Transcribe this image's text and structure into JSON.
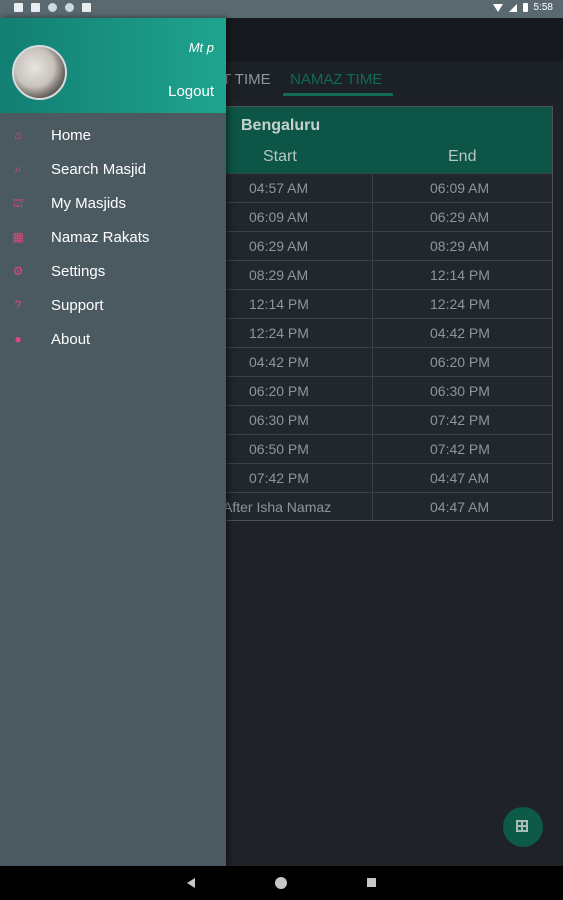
{
  "status_bar": {
    "time": "5:58",
    "left_icons": [
      "notification-icon",
      "gallery-icon",
      "google-icon",
      "circle-icon",
      "file-icon"
    ]
  },
  "tabs": {
    "first_partial": "T TIME",
    "active": "NAMAZ TIME"
  },
  "table": {
    "city": "Bengaluru",
    "headers": {
      "start": "Start",
      "end": "End"
    },
    "rows": [
      {
        "start": "04:57 AM",
        "end": "06:09 AM"
      },
      {
        "start": "06:09 AM",
        "end": "06:29 AM"
      },
      {
        "start": "06:29 AM",
        "end": "08:29 AM"
      },
      {
        "start": "08:29 AM",
        "end": "12:14 PM"
      },
      {
        "start": "12:14 PM",
        "end": "12:24 PM"
      },
      {
        "start": "12:24 PM",
        "end": "04:42 PM"
      },
      {
        "start": "04:42 PM",
        "end": "06:20 PM"
      },
      {
        "start": "06:20 PM",
        "end": "06:30 PM"
      },
      {
        "start": "06:30 PM",
        "end": "07:42 PM"
      },
      {
        "start": "06:50 PM",
        "end": "07:42 PM"
      },
      {
        "start": "07:42 PM",
        "end": "04:47 AM"
      },
      {
        "start": "After Isha Namaz",
        "end": "04:47 AM"
      }
    ]
  },
  "drawer": {
    "user_name": "Mt p",
    "logout_label": "Logout",
    "accent_color": "#e0477d",
    "items": [
      {
        "label": "Home",
        "icon": "home-icon"
      },
      {
        "label": "Search Masjid",
        "icon": "search-icon"
      },
      {
        "label": "My Masjids",
        "icon": "masjid-icon"
      },
      {
        "label": "Namaz Rakats",
        "icon": "table-icon"
      },
      {
        "label": "Settings",
        "icon": "gear-icon"
      },
      {
        "label": "Support",
        "icon": "help-icon"
      },
      {
        "label": "About",
        "icon": "info-icon"
      }
    ]
  },
  "fab": {
    "icon": "grid-icon"
  },
  "nav_bar": {
    "icons": [
      "back-icon",
      "home-button-icon",
      "recents-icon"
    ]
  }
}
